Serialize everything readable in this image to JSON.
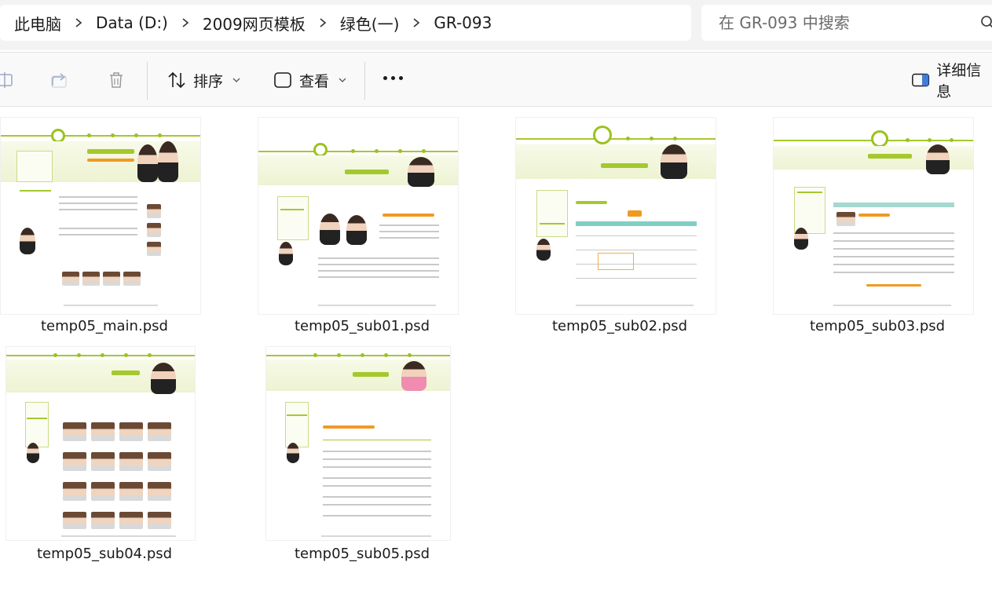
{
  "address_bar": {
    "crumbs": [
      "此电脑",
      "Data (D:)",
      "2009网页模板",
      "绿色(一)",
      "GR-093"
    ]
  },
  "search": {
    "placeholder": "在 GR-093 中搜索"
  },
  "toolbar": {
    "sort_label": "排序",
    "view_label": "查看",
    "details_label": "详细信息"
  },
  "files": [
    {
      "name": "temp05_main.psd"
    },
    {
      "name": "temp05_sub01.psd"
    },
    {
      "name": "temp05_sub02.psd"
    },
    {
      "name": "temp05_sub03.psd"
    },
    {
      "name": "temp05_sub04.psd"
    },
    {
      "name": "temp05_sub05.psd"
    }
  ],
  "colors": {
    "accent_green": "#9bc21e",
    "accent_orange": "#f09a22",
    "teal": "#7fcfc4"
  }
}
